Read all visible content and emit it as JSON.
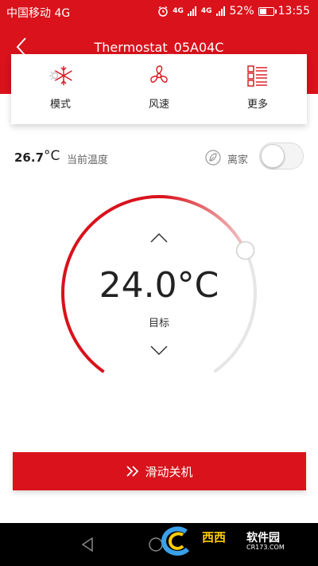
{
  "status_bar": {
    "carrier": "中国移动 4G",
    "net_a": "4G",
    "net_b": "4G",
    "battery_percent": "52%",
    "battery_level": 0.52,
    "time": "13:55"
  },
  "header": {
    "title": "Thermostat_05A04C"
  },
  "tools": [
    {
      "label": "模式",
      "icon": "snowflake-sun-icon"
    },
    {
      "label": "风速",
      "icon": "fan-icon"
    },
    {
      "label": "更多",
      "icon": "list-icon"
    }
  ],
  "current": {
    "value": "26.7",
    "unit": "°C",
    "label": "当前温度"
  },
  "away": {
    "label": "离家",
    "on": false
  },
  "target": {
    "value": "24.0°C",
    "label": "目标",
    "arc_fraction": 0.72
  },
  "actions": {
    "slide_off": "滑动关机"
  },
  "watermark": {
    "brand": "西西",
    "site": "软件园",
    "url": "CR173.COM"
  },
  "colors": {
    "primary": "#d9121b",
    "track": "#e6e6e6"
  }
}
